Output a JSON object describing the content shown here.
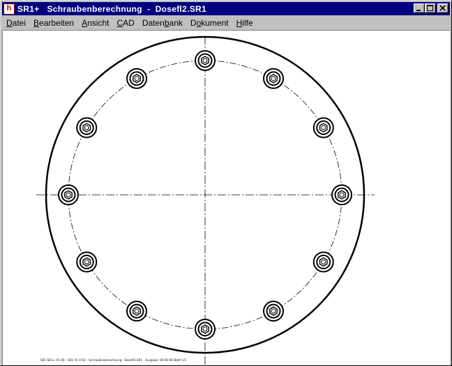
{
  "window": {
    "app_icon_letter": "ĥ",
    "title": "SR1+   Schraubenberechnung  -  Dosefl2.SR1"
  },
  "menu": [
    {
      "label": "Datei",
      "accel": "D"
    },
    {
      "label": "Bearbeiten",
      "accel": "B"
    },
    {
      "label": "Ansicht",
      "accel": "A"
    },
    {
      "label": "CAD",
      "accel": "C"
    },
    {
      "label": "Datenbank",
      "accel": "b"
    },
    {
      "label": "Dokument",
      "accel": "o"
    },
    {
      "label": "Hilfe",
      "accel": "H"
    }
  ],
  "drawing": {
    "bolt_count": 12,
    "footer_text": "SR1 SR1+ V1.00 - SR1 V1.0 R2 - Schraubenberechnung - Dosefl2.SR1 - Ausgabe: 00.00.00 Blatt 1/1"
  },
  "colors": {
    "titlebar": "#000080",
    "chrome": "#c0c0c0",
    "canvas": "#ffffff",
    "ink": "#000000"
  }
}
